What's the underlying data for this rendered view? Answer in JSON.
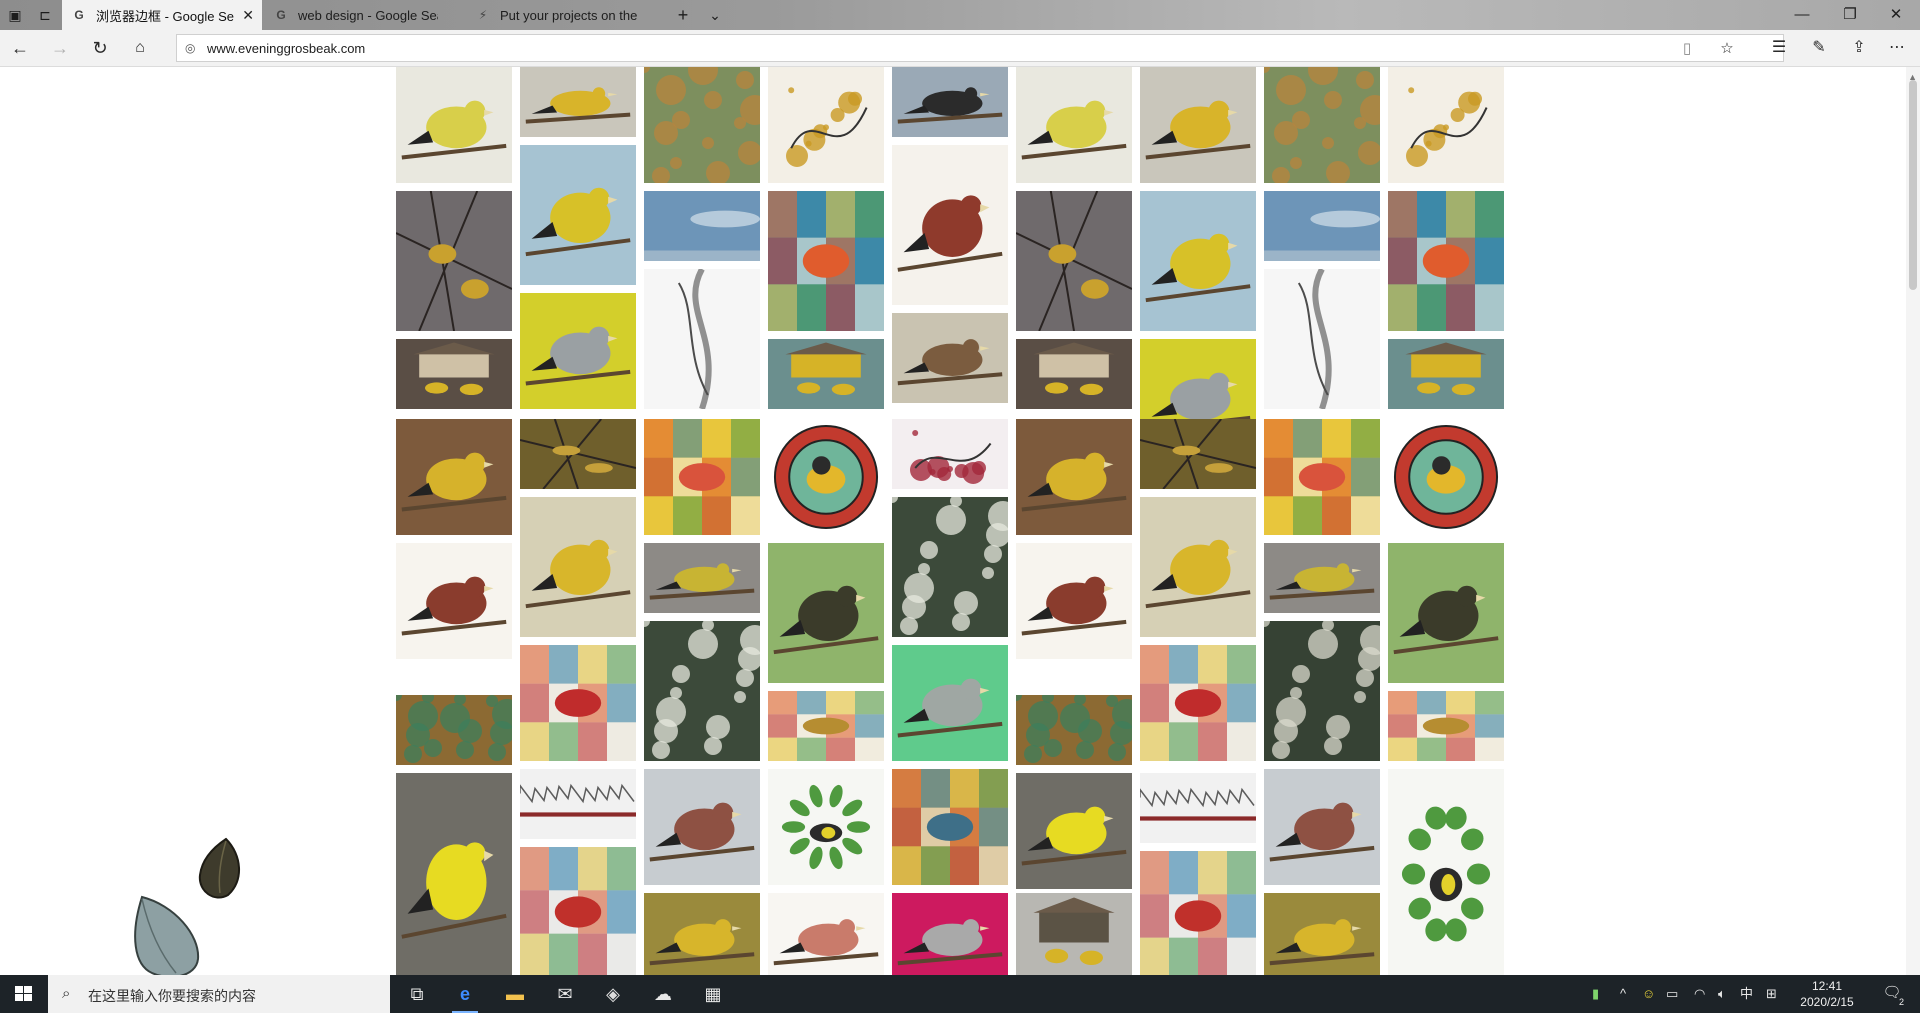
{
  "browser": {
    "tabs": [
      {
        "title": "浏览器边框 - Google Se",
        "favicon": "google-icon",
        "active": true
      },
      {
        "title": "web design - Google Search",
        "favicon": "google-icon",
        "active": false
      },
      {
        "title": "Put your projects on the We",
        "favicon": "lightning-icon",
        "active": false
      }
    ],
    "address": "www.eveninggrosbeak.com"
  },
  "taskbar": {
    "search_placeholder": "在这里输入你要搜索的内容",
    "ime_label": "中",
    "time": "12:41",
    "date": "2020/2/15",
    "notification_count": "2"
  },
  "gallery": {
    "tiles": [
      {
        "name": "wagtails-wallpaper",
        "bg": "#e9e8df",
        "accent": "#d8cf4a",
        "motif": "bird"
      },
      {
        "name": "grosbeak-branch-photo",
        "bg": "#c9c6bb",
        "accent": "#d8b42a",
        "motif": "bird"
      },
      {
        "name": "birds-tree-collage",
        "bg": "#7d8f5e",
        "accent": "#b8843e",
        "motif": "foliage"
      },
      {
        "name": "grosbeak-ink-splash",
        "bg": "#f3efe6",
        "accent": "#c99a23",
        "motif": "splash"
      },
      {
        "name": "tit-reflection-water",
        "bg": "#9aa9b6",
        "accent": "#2b2b2b",
        "motif": "bird"
      },
      {
        "name": "grosbeaks-bare-tree",
        "bg": "#6f6a6c",
        "accent": "#c9a12e",
        "motif": "branches"
      },
      {
        "name": "grosbeak-yellow-painting",
        "bg": "#a6c3d2",
        "accent": "#d7c128",
        "motif": "bird"
      },
      {
        "name": "sky-clouds",
        "bg": "#6d95b8",
        "accent": "#c7d7e4",
        "motif": "sky"
      },
      {
        "name": "birds-colorful-collage",
        "bg": "#4f95a8",
        "accent": "#e05c2d",
        "motif": "collage"
      },
      {
        "name": "shrike-illustration",
        "bg": "#f5f2ec",
        "accent": "#8f3a2c",
        "motif": "bird"
      },
      {
        "name": "sparrow-yellow-print",
        "bg": "#d3cf2b",
        "accent": "#9aa0a3",
        "motif": "bird"
      },
      {
        "name": "ink-drip-tree",
        "bg": "#f6f6f6",
        "accent": "#4c4c4c",
        "motif": "ink"
      },
      {
        "name": "sparrow-poster",
        "bg": "#c9c3b1",
        "accent": "#7b5c3f",
        "motif": "bird"
      },
      {
        "name": "bird-feeder-snow",
        "bg": "#5a4e45",
        "accent": "#cfc1a6",
        "motif": "feeder"
      },
      {
        "name": "grosbeaks-feeder-teal",
        "bg": "#6b8f8e",
        "accent": "#d6b327",
        "motif": "feeder"
      },
      {
        "name": "grosbeak-pine-painting",
        "bg": "#7d5a3c",
        "accent": "#d6b22b",
        "motif": "bird"
      },
      {
        "name": "grosbeaks-olive-branch",
        "bg": "#6f5f2c",
        "accent": "#c5a03a",
        "motif": "branches"
      },
      {
        "name": "chaffinch-pattern",
        "bg": "#e8c63c",
        "accent": "#d9533c",
        "motif": "collage"
      },
      {
        "name": "evening-grosbeak-badge",
        "bg": "#ffffff",
        "accent": "#c23a2e",
        "motif": "badge"
      },
      {
        "name": "abstract-splatter",
        "bg": "#f3eef0",
        "accent": "#a2283b",
        "motif": "splash"
      },
      {
        "name": "finches-illustration",
        "bg": "#f7f4ee",
        "accent": "#8a3c2d",
        "motif": "bird"
      },
      {
        "name": "grosbeak-confetti",
        "bg": "#d6d0b5",
        "accent": "#d8b62b",
        "motif": "bird"
      },
      {
        "name": "tit-wings-spread",
        "bg": "#8d8a86",
        "accent": "#c8b433",
        "motif": "bird"
      },
      {
        "name": "tit-green-reflection",
        "bg": "#8fb46b",
        "accent": "#3b3b2a",
        "motif": "bird"
      },
      {
        "name": "blossom-dark-bush",
        "bg": "#3c4a3a",
        "accent": "#e5e8dd",
        "motif": "foliage"
      },
      {
        "name": "birds-doodle-collage",
        "bg": "#e9e6dd",
        "accent": "#c02c2c",
        "motif": "collage"
      },
      {
        "name": "bird-blossoms-green",
        "bg": "#364234",
        "accent": "#d9d9cc",
        "motif": "foliage"
      },
      {
        "name": "golden-birds-pattern",
        "bg": "#efe9d6",
        "accent": "#b68d31",
        "motif": "collage"
      },
      {
        "name": "sparrow-mint-print",
        "bg": "#5fcb8c",
        "accent": "#9fa7a3",
        "motif": "bird"
      },
      {
        "name": "parrots-autumn",
        "bg": "#8c6a33",
        "accent": "#3d7f5c",
        "motif": "foliage"
      },
      {
        "name": "canary-feeder",
        "bg": "#6f6d66",
        "accent": "#e7db22",
        "motif": "bird"
      },
      {
        "name": "sound-waveform",
        "bg": "#f1f1f1",
        "accent": "#5c5c5c",
        "motif": "wave"
      },
      {
        "name": "rosefinch-gray",
        "bg": "#c7ccd0",
        "accent": "#8e5143",
        "motif": "bird"
      },
      {
        "name": "warbler-leaves",
        "bg": "#f6f7f3",
        "accent": "#4f9a3f",
        "motif": "leaves"
      },
      {
        "name": "birds-audubon",
        "bg": "#c8a25a",
        "accent": "#3e6f88",
        "motif": "collage"
      },
      {
        "name": "birds-snow-cardinal",
        "bg": "#dfe4ea",
        "accent": "#c0302b",
        "motif": "collage"
      },
      {
        "name": "bird-yellow-ground",
        "bg": "#9a8a3c",
        "accent": "#d7b52b",
        "motif": "bird"
      },
      {
        "name": "two-finches-sketch",
        "bg": "#f8f6f2",
        "accent": "#c97b6b",
        "motif": "bird"
      },
      {
        "name": "sparrow-pink-print",
        "bg": "#cd1a5f",
        "accent": "#a9a9a9",
        "motif": "bird"
      },
      {
        "name": "snow-feeder-yard",
        "bg": "#b8b7b2",
        "accent": "#5b5345",
        "motif": "feeder"
      }
    ]
  }
}
